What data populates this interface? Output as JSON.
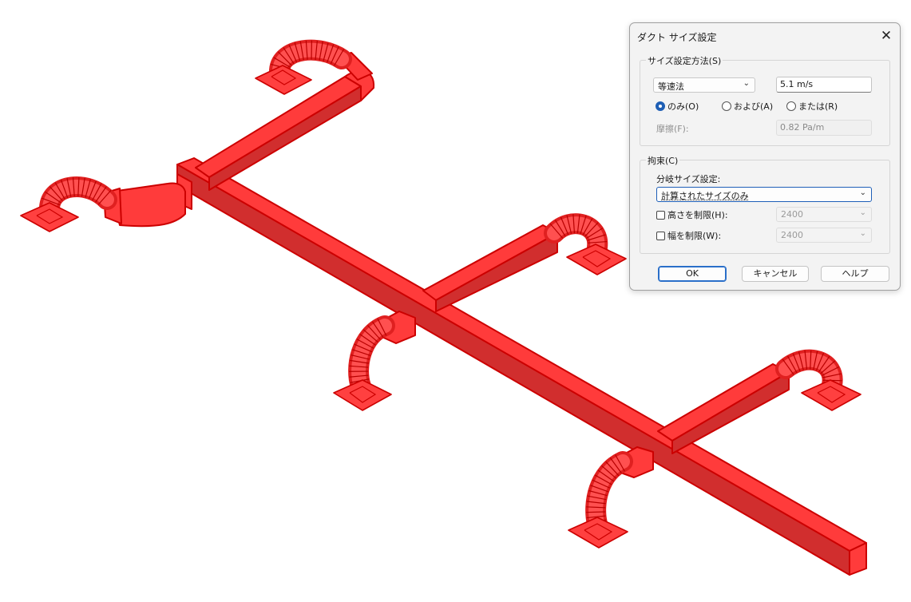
{
  "dialog": {
    "title": "ダクト サイズ設定",
    "close_glyph": "✕",
    "sizing_method": {
      "group_label": "サイズ設定方法(S)",
      "method_selected": "等速法",
      "method_value": "5.1 m/s",
      "radios": [
        {
          "label": "のみ(O)",
          "selected": true
        },
        {
          "label": "および(A)",
          "selected": false
        },
        {
          "label": "または(R)",
          "selected": false
        }
      ],
      "friction_label": "摩擦(F):",
      "friction_value": "0.82 Pa/m"
    },
    "constraints": {
      "group_label": "拘束(C)",
      "branch_label": "分岐サイズ設定:",
      "branch_selected": "計算されたサイズのみ",
      "height_limit_label": "高さを制限(H):",
      "height_limit_value": "2400",
      "width_limit_label": "幅を制限(W):",
      "width_limit_value": "2400"
    },
    "buttons": {
      "ok": "OK",
      "cancel": "キャンセル",
      "help": "ヘルプ"
    }
  },
  "colors": {
    "duct_fill": "#ff3b3b",
    "duct_edge": "#cc0000",
    "accent": "#1f5fb5"
  },
  "icons": {
    "combo_arrow": "chevron-down-icon",
    "close": "close-icon"
  }
}
